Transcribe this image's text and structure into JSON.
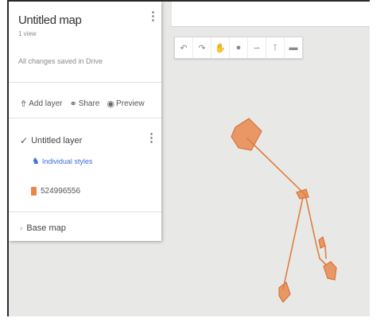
{
  "sidebar": {
    "title": "Untitled map",
    "views": "1 view",
    "save_status": "All changes saved in Drive",
    "actions": [
      {
        "label": "Add layer",
        "icon": "add-layer-icon"
      },
      {
        "label": "Share",
        "icon": "share-icon"
      },
      {
        "label": "Preview",
        "icon": "preview-icon"
      }
    ],
    "layer": {
      "name": "Untitled layer",
      "checked": true,
      "style_link": "Individual styles",
      "feature": "524996556"
    },
    "basemap": "Base map"
  },
  "toolbar": {
    "tools": [
      "undo-icon",
      "redo-icon",
      "pan-hand-icon",
      "marker-icon",
      "draw-line-icon",
      "directions-icon",
      "ruler-icon"
    ]
  },
  "map": {
    "background": "#e8e8e6",
    "feature_color": "#e8884d"
  }
}
